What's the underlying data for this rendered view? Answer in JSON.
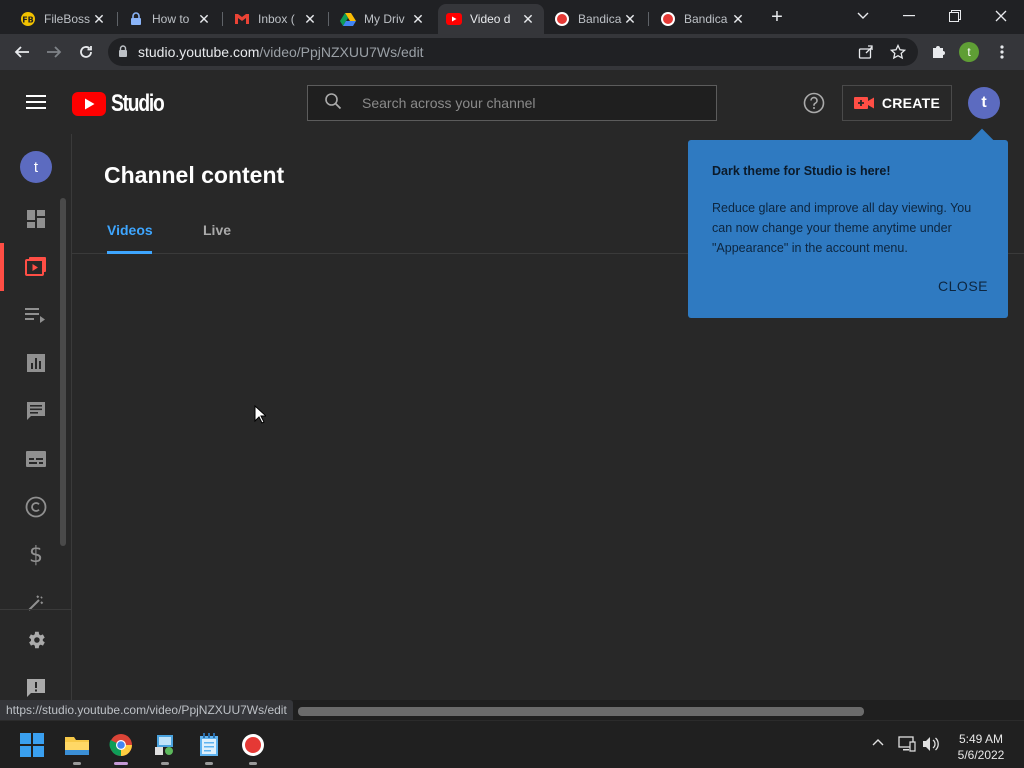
{
  "browser": {
    "tabs": [
      {
        "title": "FileBoss",
        "icon": "fileboss-icon",
        "active": false
      },
      {
        "title": "How to",
        "icon": "lock-icon",
        "active": false
      },
      {
        "title": "Inbox (",
        "icon": "gmail-icon",
        "active": false
      },
      {
        "title": "My Driv",
        "icon": "google-drive-icon",
        "active": false
      },
      {
        "title": "Video d",
        "icon": "youtube-icon",
        "active": true
      },
      {
        "title": "Bandica",
        "icon": "bandicam-icon",
        "active": false
      },
      {
        "title": "Bandica",
        "icon": "bandicam-icon",
        "active": false
      }
    ],
    "url_host": "studio.youtube.com",
    "url_path": "/video/PpjNZXUU7Ws/edit",
    "profile_initial": "t",
    "status_url": "https://studio.youtube.com/video/PpjNZXUU7Ws/edit"
  },
  "studio": {
    "logo_text": "Studio",
    "search_placeholder": "Search across your channel",
    "create_label": "CREATE",
    "avatar_initial": "t",
    "sidebar_avatar_initial": "t",
    "sidebar_items": [
      {
        "name": "dashboard-icon",
        "active": false
      },
      {
        "name": "content-icon",
        "active": true
      },
      {
        "name": "playlists-icon",
        "active": false
      },
      {
        "name": "analytics-icon",
        "active": false
      },
      {
        "name": "comments-icon",
        "active": false
      },
      {
        "name": "subtitles-icon",
        "active": false
      },
      {
        "name": "copyright-icon",
        "active": false
      },
      {
        "name": "monetization-icon",
        "active": false
      },
      {
        "name": "customization-icon",
        "active": false
      }
    ],
    "page_title": "Channel content",
    "content_tabs": [
      {
        "label": "Videos",
        "active": true
      },
      {
        "label": "Live",
        "active": false
      }
    ],
    "popup": {
      "title": "Dark theme for Studio is here!",
      "body": "Reduce glare and improve all day viewing. You can now change your theme anytime under \"Appearance\" in the account menu.",
      "close_label": "CLOSE"
    }
  },
  "taskbar": {
    "time": "5:49 AM",
    "date": "5/6/2022"
  },
  "colors": {
    "accent_blue": "#3ea6ff",
    "youtube_red": "#ff0000",
    "popup_bg": "#2f7ac1",
    "avatar": "#5c6bc0"
  }
}
